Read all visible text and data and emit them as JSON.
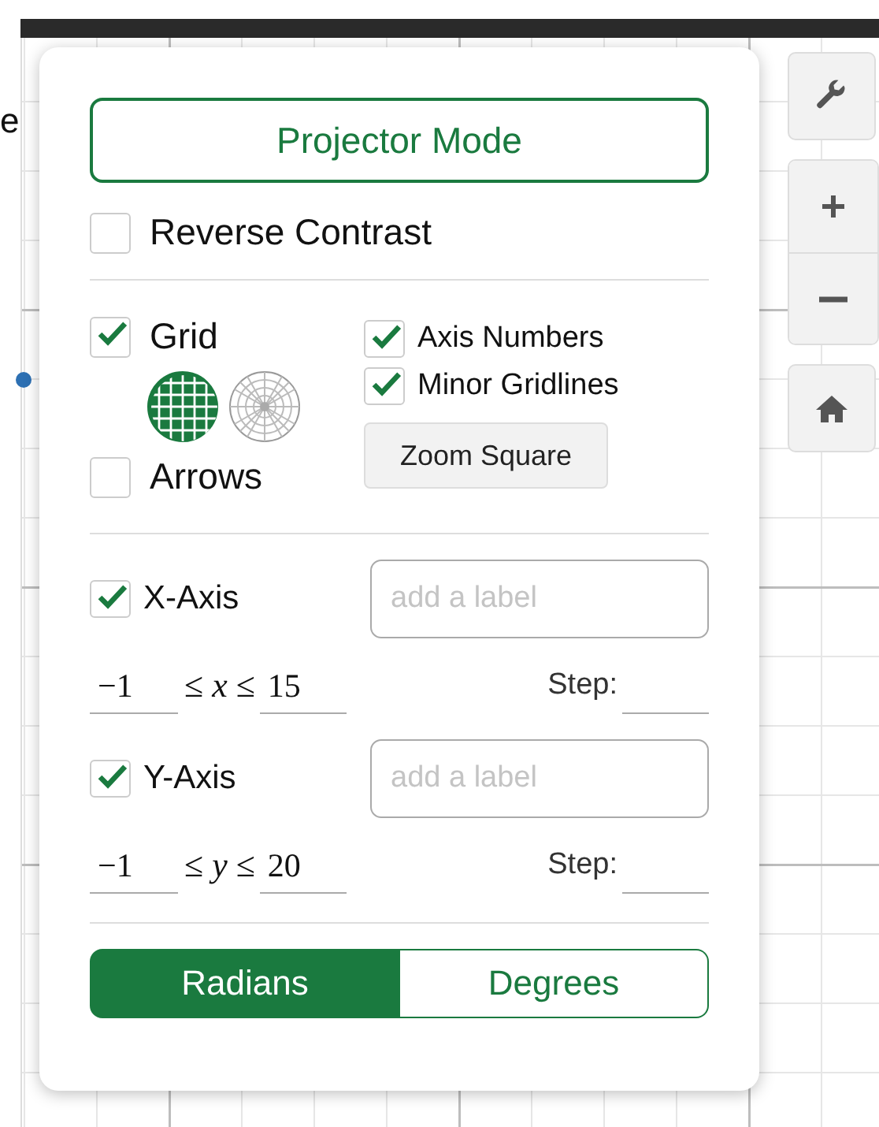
{
  "page": {
    "edge_text": "e"
  },
  "settings": {
    "projector_mode": {
      "label": "Projector Mode"
    },
    "reverse_contrast": {
      "label": "Reverse Contrast",
      "checked": false
    },
    "grid": {
      "label": "Grid",
      "checked": true,
      "types": [
        {
          "kind": "cartesian",
          "selected": true
        },
        {
          "kind": "polar",
          "selected": false
        }
      ]
    },
    "arrows": {
      "label": "Arrows",
      "checked": false
    },
    "axis_numbers": {
      "label": "Axis Numbers",
      "checked": true
    },
    "minor_gridlines": {
      "label": "Minor Gridlines",
      "checked": true
    },
    "zoom_square": {
      "label": "Zoom Square"
    },
    "axes": [
      {
        "label": "X-Axis",
        "checked": true,
        "placeholder": "add a label",
        "min": "−1",
        "inequality": "≤ *x* ≤",
        "max": "15",
        "step_label": "Step:"
      },
      {
        "label": "Y-Axis",
        "checked": true,
        "placeholder": "add a label",
        "min": "−1",
        "inequality": "≤ *y* ≤",
        "max": "20",
        "step_label": "Step:"
      }
    ],
    "angle_units": [
      {
        "label": "Radians",
        "selected": true
      },
      {
        "label": "Degrees",
        "selected": false
      }
    ]
  }
}
